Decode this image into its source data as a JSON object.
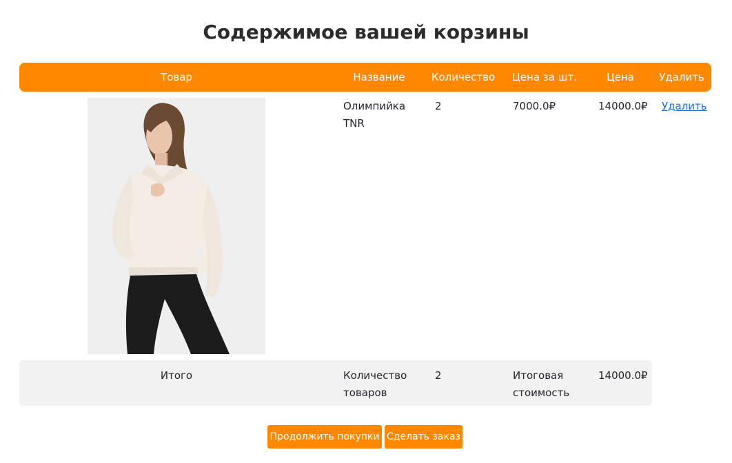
{
  "page": {
    "title": "Содержимое вашей корзины"
  },
  "table": {
    "headers": {
      "product": "Товар",
      "name": "Название",
      "quantity": "Количество",
      "unit_price": "Цена за шт.",
      "price": "Цена",
      "delete": "Удалить"
    },
    "rows": [
      {
        "name_line1": "Олимпийка",
        "name_line2": "TNR",
        "quantity": "2",
        "unit_price": "7000.0₽",
        "price": "14000.0₽",
        "delete_label": "Удалить"
      }
    ],
    "total": {
      "label": "Итого",
      "count_label_line1": "Количество",
      "count_label_line2": "товаров",
      "count": "2",
      "cost_label_line1": "Итоговая",
      "cost_label_line2": "стоимость",
      "cost": "14000.0₽"
    }
  },
  "actions": {
    "continue_label": "Продолжить покупки",
    "order_label": "Сделать заказ"
  },
  "colors": {
    "accent": "#ff8800",
    "link": "#1a6ed8",
    "total_bg": "#f2f2f2"
  }
}
